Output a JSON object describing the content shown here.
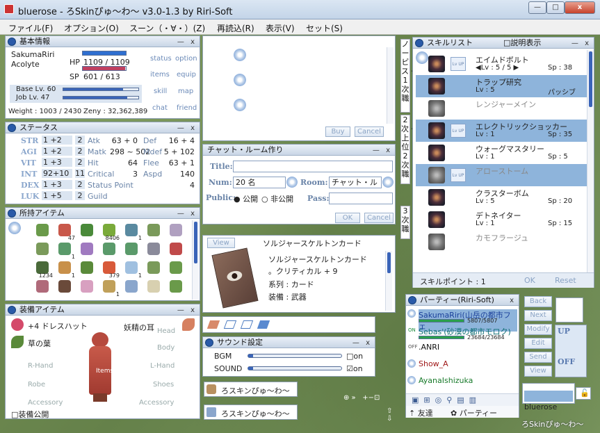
{
  "window": {
    "title": "bluerose - ろSkinぴゅ～わ～ v3.0-1.3 by Riri-Soft",
    "minimize": "—",
    "maximize": "□",
    "close": "x"
  },
  "menu": [
    "ファイル(F)",
    "オプション(O)",
    "スーン（・∀・）(Z)",
    "再読込(R)",
    "表示(V)",
    "セット(S)"
  ],
  "basic": {
    "title": "基本情報",
    "name": "SakumaRiri",
    "job": "Acolyte",
    "hp_label": "HP",
    "hp": "1109 / 1109",
    "hp_ratio": 1.0,
    "sp_label": "SP",
    "sp": "601 / 613",
    "sp_ratio": 0.98,
    "base": "Base Lv. 60",
    "job_lv": "Job Lv. 47",
    "base_ratio": 0.8,
    "job_ratio": 0.85,
    "weight": "Weight : 1003 / 2430",
    "zeny": "Zeny : 32,362,389",
    "links": [
      "status",
      "option",
      "items",
      "equip",
      "skill",
      "map",
      "chat",
      "friend"
    ]
  },
  "status": {
    "title": "ステータス",
    "stats": [
      {
        "name": "STR",
        "val": "1 +2",
        "pts": "2"
      },
      {
        "name": "AGI",
        "val": "1 +2",
        "pts": "2"
      },
      {
        "name": "VIT",
        "val": "1 +3",
        "pts": "2"
      },
      {
        "name": "INT",
        "val": "92+10",
        "pts": "11"
      },
      {
        "name": "DEX",
        "val": "1 +3",
        "pts": "2"
      },
      {
        "name": "LUK",
        "val": "1 +5",
        "pts": "2"
      }
    ],
    "left": [
      {
        "k": "Atk",
        "v": "63 + 0"
      },
      {
        "k": "Matk",
        "v": "298 ~ 502"
      },
      {
        "k": "Hit",
        "v": "64"
      },
      {
        "k": "Critical",
        "v": "3"
      },
      {
        "k": "Status Point",
        "v": ""
      },
      {
        "k": "Guild",
        "v": ""
      }
    ],
    "right": [
      {
        "k": "Def",
        "v": "16 + 4"
      },
      {
        "k": "Mdef",
        "v": "5 + 102"
      },
      {
        "k": "Flee",
        "v": "63 + 1"
      },
      {
        "k": "Aspd",
        "v": "140"
      },
      {
        "k": "",
        "v": "4"
      }
    ]
  },
  "items": {
    "title": "所持アイテム",
    "counts": [
      "",
      "47",
      "",
      "8406",
      "1",
      "",
      "",
      "",
      "1",
      "",
      "",
      "",
      "",
      "",
      "1234",
      "1",
      "",
      "379",
      "1",
      "",
      "",
      "",
      "",
      "",
      "1",
      "",
      "",
      ""
    ]
  },
  "equip": {
    "title": "装備アイテム",
    "left": [
      "+4 ドレスハット",
      "草の葉",
      "R-Hand",
      "Robe",
      "Accessory"
    ],
    "right": [
      "妖精の耳",
      "Head",
      "Body",
      "L-Hand",
      "Shoes",
      "Accessory"
    ],
    "center": "Items",
    "public": "装備公開"
  },
  "shop": {
    "buy": "Buy",
    "cancel": "Cancel"
  },
  "chat": {
    "title": "チャット・ルーム作り",
    "title_label": "Title:",
    "num_label": "Num:",
    "num": "20 名",
    "room_label": "Room:",
    "room": "チャット・ルーム",
    "public_label": "Public:",
    "public": "公開",
    "private": "非公開",
    "pass_label": "Pass:",
    "ok": "OK",
    "cancel": "Cancel"
  },
  "card": {
    "view": "View",
    "name": "ソルジャースケルトンカード",
    "desc1": "ソルジャースケルトンカード",
    "desc2": "。クリティカル + 9",
    "desc3": "系列 : カード",
    "desc4": "装備 : 武器"
  },
  "sound": {
    "title": "サウンド設定",
    "bgm": "BGM",
    "sound": "SOUND",
    "on": "on",
    "bgm_level": 0.05,
    "sound_level": 0.05
  },
  "buttons": {
    "skin1": "ろスキンぴゅ～わ～",
    "skin2": "ろスキンぴゅ～わ～"
  },
  "vtabs": [
    "ノービス・1次職",
    "2次・上位2次職",
    "3次職"
  ],
  "skills": {
    "title": "スキルリスト",
    "explain": "説明表示",
    "points": "スキルポイント : 1",
    "ok": "OK",
    "reset": "Reset",
    "list": [
      {
        "name": "エイムドボルト",
        "lv": "◀Lv : 5 / 5 ▶",
        "sp": "Sp : 38",
        "sel": false,
        "dim": false,
        "up": true
      },
      {
        "name": "トラップ研究",
        "lv": "Lv : 5",
        "sp": "パッシブ",
        "sel": true,
        "dim": false,
        "up": false
      },
      {
        "name": "レンジャーメイン",
        "lv": "",
        "sp": "",
        "sel": false,
        "dim": true,
        "up": false
      },
      {
        "name": "エレクトリックショッカー",
        "lv": "Lv : 1",
        "sp": "Sp : 35",
        "sel": true,
        "dim": false,
        "up": true
      },
      {
        "name": "ウォーグマスタリー",
        "lv": "Lv : 1",
        "sp": "Sp : 5",
        "sel": false,
        "dim": false,
        "up": false
      },
      {
        "name": "アローストーム",
        "lv": "",
        "sp": "",
        "sel": true,
        "dim": true,
        "up": true
      },
      {
        "name": "クラスターボム",
        "lv": "Lv : 5",
        "sp": "Sp : 20",
        "sel": false,
        "dim": false,
        "up": false
      },
      {
        "name": "デトネイター",
        "lv": "Lv : 1",
        "sp": "Sp : 15",
        "sel": false,
        "dim": false,
        "up": false
      },
      {
        "name": "カモフラージュ",
        "lv": "",
        "sp": "",
        "sel": false,
        "dim": true,
        "up": false
      }
    ]
  },
  "party": {
    "title": "パーティー(Riri-Soft)",
    "members": [
      {
        "name": "SakumaRiri(山岳の都市フェ",
        "hp": "5807/5807",
        "ratio": 1.0,
        "status": "",
        "color": "#1a3f9a",
        "sel": true
      },
      {
        "name": "Sebas'(砂漠の都市モロク)",
        "hp": "23684/23684",
        "ratio": 1.0,
        "status": "ON",
        "color": "#0e6e74",
        "sel": false
      },
      {
        "name": ".ANRI",
        "hp": "",
        "ratio": 0,
        "status": "OFF",
        "color": "#111",
        "sel": false
      },
      {
        "name": "Show_A",
        "hp": "",
        "ratio": 0,
        "status": "",
        "color": "#a01a1a",
        "sel": false
      },
      {
        "name": "AyanaIshizuka",
        "hp": "",
        "ratio": 0,
        "status": "",
        "color": "#187a2a",
        "sel": false
      }
    ],
    "friends_tab": "友達",
    "party_tab": "パーティー"
  },
  "side": {
    "back": "Back",
    "next": "Next",
    "modify": "Modify",
    "edit": "Edit",
    "send": "Send",
    "view": "View",
    "up": "UP",
    "off": "OFF"
  },
  "nameplate": {
    "name": "bluerose",
    "skin": "ろSkinぴゅ～わ～"
  }
}
